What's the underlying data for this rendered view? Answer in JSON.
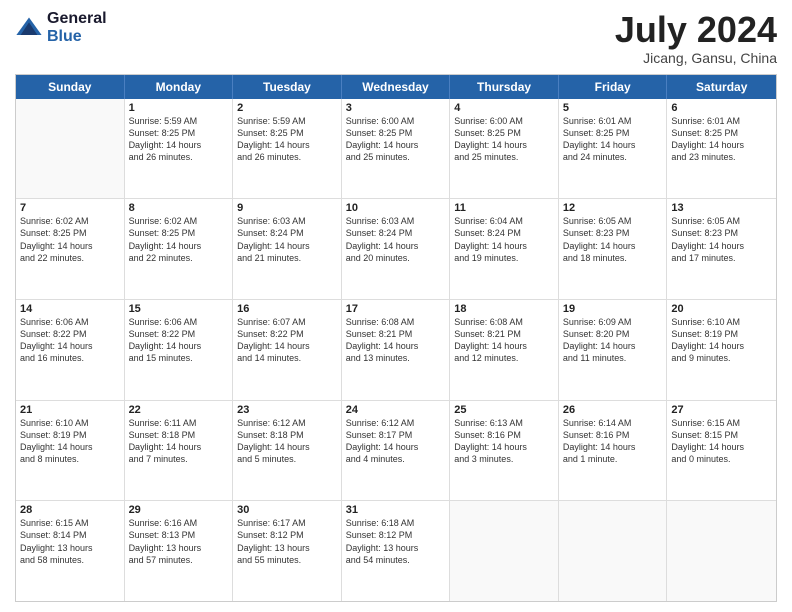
{
  "logo": {
    "general": "General",
    "blue": "Blue"
  },
  "title": "July 2024",
  "location": "Jicang, Gansu, China",
  "header_days": [
    "Sunday",
    "Monday",
    "Tuesday",
    "Wednesday",
    "Thursday",
    "Friday",
    "Saturday"
  ],
  "weeks": [
    [
      {
        "day": "",
        "info": ""
      },
      {
        "day": "1",
        "info": "Sunrise: 5:59 AM\nSunset: 8:25 PM\nDaylight: 14 hours\nand 26 minutes."
      },
      {
        "day": "2",
        "info": "Sunrise: 5:59 AM\nSunset: 8:25 PM\nDaylight: 14 hours\nand 26 minutes."
      },
      {
        "day": "3",
        "info": "Sunrise: 6:00 AM\nSunset: 8:25 PM\nDaylight: 14 hours\nand 25 minutes."
      },
      {
        "day": "4",
        "info": "Sunrise: 6:00 AM\nSunset: 8:25 PM\nDaylight: 14 hours\nand 25 minutes."
      },
      {
        "day": "5",
        "info": "Sunrise: 6:01 AM\nSunset: 8:25 PM\nDaylight: 14 hours\nand 24 minutes."
      },
      {
        "day": "6",
        "info": "Sunrise: 6:01 AM\nSunset: 8:25 PM\nDaylight: 14 hours\nand 23 minutes."
      }
    ],
    [
      {
        "day": "7",
        "info": "Sunrise: 6:02 AM\nSunset: 8:25 PM\nDaylight: 14 hours\nand 22 minutes."
      },
      {
        "day": "8",
        "info": "Sunrise: 6:02 AM\nSunset: 8:25 PM\nDaylight: 14 hours\nand 22 minutes."
      },
      {
        "day": "9",
        "info": "Sunrise: 6:03 AM\nSunset: 8:24 PM\nDaylight: 14 hours\nand 21 minutes."
      },
      {
        "day": "10",
        "info": "Sunrise: 6:03 AM\nSunset: 8:24 PM\nDaylight: 14 hours\nand 20 minutes."
      },
      {
        "day": "11",
        "info": "Sunrise: 6:04 AM\nSunset: 8:24 PM\nDaylight: 14 hours\nand 19 minutes."
      },
      {
        "day": "12",
        "info": "Sunrise: 6:05 AM\nSunset: 8:23 PM\nDaylight: 14 hours\nand 18 minutes."
      },
      {
        "day": "13",
        "info": "Sunrise: 6:05 AM\nSunset: 8:23 PM\nDaylight: 14 hours\nand 17 minutes."
      }
    ],
    [
      {
        "day": "14",
        "info": "Sunrise: 6:06 AM\nSunset: 8:22 PM\nDaylight: 14 hours\nand 16 minutes."
      },
      {
        "day": "15",
        "info": "Sunrise: 6:06 AM\nSunset: 8:22 PM\nDaylight: 14 hours\nand 15 minutes."
      },
      {
        "day": "16",
        "info": "Sunrise: 6:07 AM\nSunset: 8:22 PM\nDaylight: 14 hours\nand 14 minutes."
      },
      {
        "day": "17",
        "info": "Sunrise: 6:08 AM\nSunset: 8:21 PM\nDaylight: 14 hours\nand 13 minutes."
      },
      {
        "day": "18",
        "info": "Sunrise: 6:08 AM\nSunset: 8:21 PM\nDaylight: 14 hours\nand 12 minutes."
      },
      {
        "day": "19",
        "info": "Sunrise: 6:09 AM\nSunset: 8:20 PM\nDaylight: 14 hours\nand 11 minutes."
      },
      {
        "day": "20",
        "info": "Sunrise: 6:10 AM\nSunset: 8:19 PM\nDaylight: 14 hours\nand 9 minutes."
      }
    ],
    [
      {
        "day": "21",
        "info": "Sunrise: 6:10 AM\nSunset: 8:19 PM\nDaylight: 14 hours\nand 8 minutes."
      },
      {
        "day": "22",
        "info": "Sunrise: 6:11 AM\nSunset: 8:18 PM\nDaylight: 14 hours\nand 7 minutes."
      },
      {
        "day": "23",
        "info": "Sunrise: 6:12 AM\nSunset: 8:18 PM\nDaylight: 14 hours\nand 5 minutes."
      },
      {
        "day": "24",
        "info": "Sunrise: 6:12 AM\nSunset: 8:17 PM\nDaylight: 14 hours\nand 4 minutes."
      },
      {
        "day": "25",
        "info": "Sunrise: 6:13 AM\nSunset: 8:16 PM\nDaylight: 14 hours\nand 3 minutes."
      },
      {
        "day": "26",
        "info": "Sunrise: 6:14 AM\nSunset: 8:16 PM\nDaylight: 14 hours\nand 1 minute."
      },
      {
        "day": "27",
        "info": "Sunrise: 6:15 AM\nSunset: 8:15 PM\nDaylight: 14 hours\nand 0 minutes."
      }
    ],
    [
      {
        "day": "28",
        "info": "Sunrise: 6:15 AM\nSunset: 8:14 PM\nDaylight: 13 hours\nand 58 minutes."
      },
      {
        "day": "29",
        "info": "Sunrise: 6:16 AM\nSunset: 8:13 PM\nDaylight: 13 hours\nand 57 minutes."
      },
      {
        "day": "30",
        "info": "Sunrise: 6:17 AM\nSunset: 8:12 PM\nDaylight: 13 hours\nand 55 minutes."
      },
      {
        "day": "31",
        "info": "Sunrise: 6:18 AM\nSunset: 8:12 PM\nDaylight: 13 hours\nand 54 minutes."
      },
      {
        "day": "",
        "info": ""
      },
      {
        "day": "",
        "info": ""
      },
      {
        "day": "",
        "info": ""
      }
    ]
  ]
}
